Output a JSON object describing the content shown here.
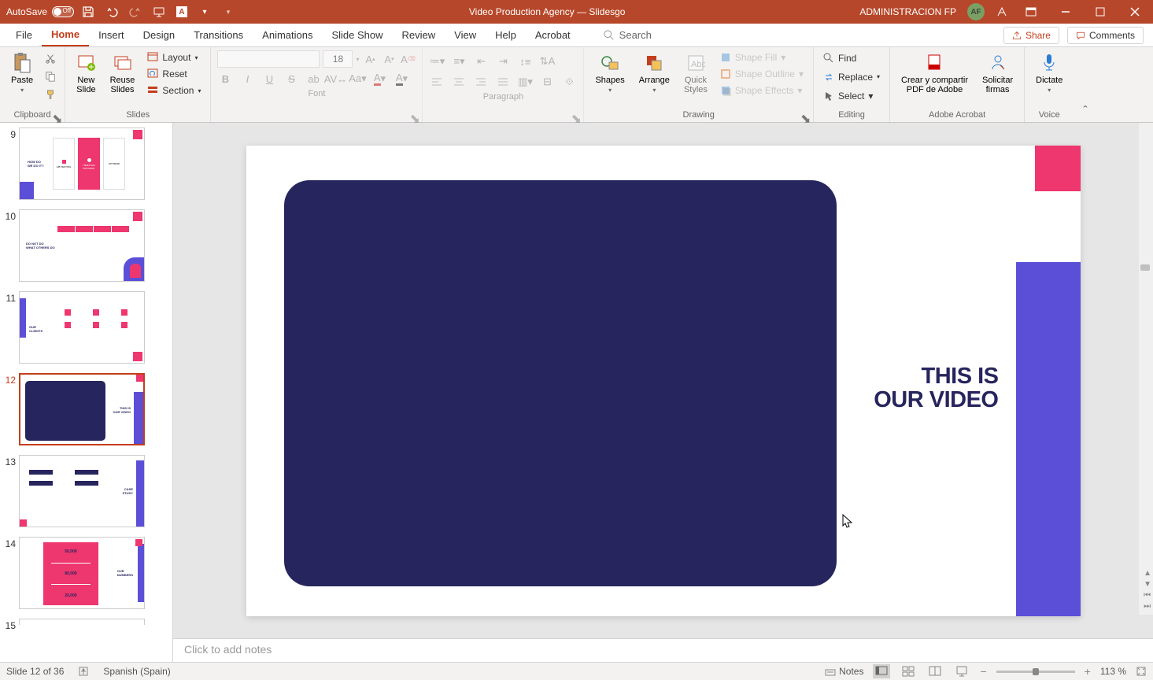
{
  "titleBar": {
    "autoSave": "AutoSave",
    "autoSaveState": "Off",
    "docTitle": "Video Production Agency — Slidesgo",
    "userName": "ADMINISTRACION FP",
    "avatarInitials": "AF"
  },
  "tabs": {
    "file": "File",
    "home": "Home",
    "insert": "Insert",
    "design": "Design",
    "transitions": "Transitions",
    "animations": "Animations",
    "slideShow": "Slide Show",
    "review": "Review",
    "view": "View",
    "help": "Help",
    "acrobat": "Acrobat",
    "search": "Search",
    "share": "Share",
    "comments": "Comments"
  },
  "ribbon": {
    "clipboard": {
      "label": "Clipboard",
      "paste": "Paste"
    },
    "slides": {
      "label": "Slides",
      "newSlide": "New\nSlide",
      "reuseSlides": "Reuse\nSlides",
      "layout": "Layout",
      "reset": "Reset",
      "section": "Section"
    },
    "font": {
      "label": "Font",
      "sizeValue": "18"
    },
    "paragraph": {
      "label": "Paragraph"
    },
    "drawing": {
      "label": "Drawing",
      "shapes": "Shapes",
      "arrange": "Arrange",
      "quickStyles": "Quick\nStyles",
      "shapeFill": "Shape Fill",
      "shapeOutline": "Shape Outline",
      "shapeEffects": "Shape Effects"
    },
    "editing": {
      "label": "Editing",
      "find": "Find",
      "replace": "Replace",
      "select": "Select"
    },
    "adobe": {
      "label": "Adobe Acrobat",
      "createShare": "Crear y compartir\nPDF de Adobe",
      "requestSig": "Solicitar\nfirmas"
    },
    "voice": {
      "label": "Voice",
      "dictate": "Dictate"
    }
  },
  "slide": {
    "titleLine1": "THIS IS",
    "titleLine2": "OUR VIDEO"
  },
  "thumbs": {
    "nums": [
      "9",
      "10",
      "11",
      "12",
      "13",
      "14",
      "15"
    ],
    "currentIndex": 3
  },
  "notes": {
    "placeholder": "Click to add notes"
  },
  "status": {
    "slideInfo": "Slide 12 of 36",
    "language": "Spanish (Spain)",
    "notes": "Notes",
    "zoom": "113 %"
  },
  "colors": {
    "brand": "#B7472A",
    "pink": "#ee366f",
    "purple": "#5b4fd8",
    "darkNavy": "#27255d"
  }
}
